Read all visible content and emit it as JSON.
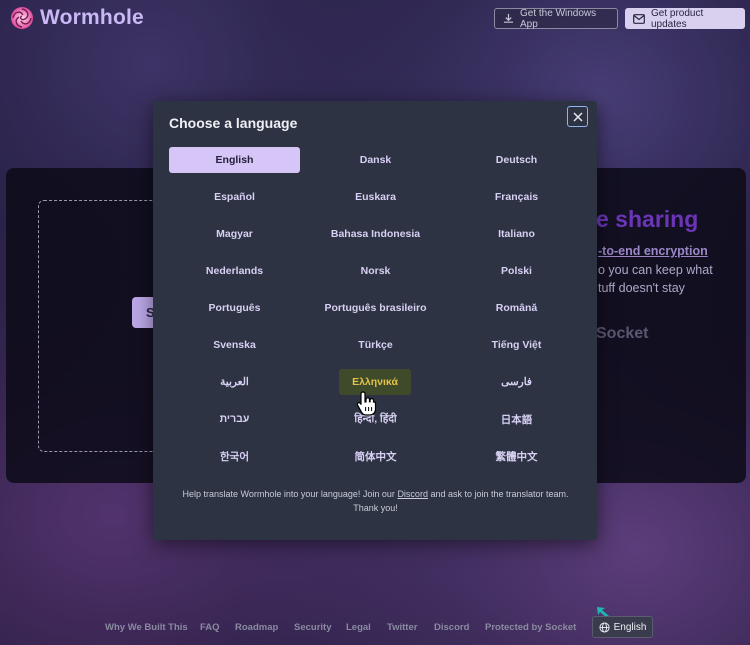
{
  "header": {
    "app_name": "Wormhole",
    "windows_app_label": "Get the Windows App",
    "updates_label": "Get product updates"
  },
  "background": {
    "select_button_label": "S",
    "headline_fragment": "e sharing",
    "e2e_fragment": "-to-end encryption",
    "line_1_fragment": "o you can keep what",
    "line_2_fragment": "tuff doesn't stay",
    "socket_label": "Socket"
  },
  "modal": {
    "title": "Choose a language",
    "languages": [
      "English",
      "Dansk",
      "Deutsch",
      "Español",
      "Euskara",
      "Français",
      "Magyar",
      "Bahasa Indonesia",
      "Italiano",
      "Nederlands",
      "Norsk",
      "Polski",
      "Português",
      "Português brasileiro",
      "Română",
      "Svenska",
      "Türkçe",
      "Tiếng Việt",
      "العربية",
      "Ελληνικά",
      "فارسی",
      "עברית",
      "हिन्दी, हिंदी",
      "日本語",
      "한국어",
      "简体中文",
      "繁體中文"
    ],
    "selected_language": "English",
    "hovered_language": "Ελληνικά",
    "help_before": "Help translate Wormhole into your language! Join our ",
    "help_link": "Discord",
    "help_after": " and ask to join the translator team.",
    "help_line_2": "Thank you!"
  },
  "footer": {
    "links": [
      "Why We Built This",
      "FAQ",
      "Roadmap",
      "Security",
      "Legal",
      "Twitter",
      "Discord",
      "Protected by Socket"
    ],
    "language_button_label": "English"
  },
  "colors": {
    "accent": "#d6c6f7",
    "modal_bg": "#2d3342",
    "hover_bg": "#3e4a2a",
    "hover_text": "#e2c24a",
    "teal_pointer": "#1fb8b0"
  }
}
